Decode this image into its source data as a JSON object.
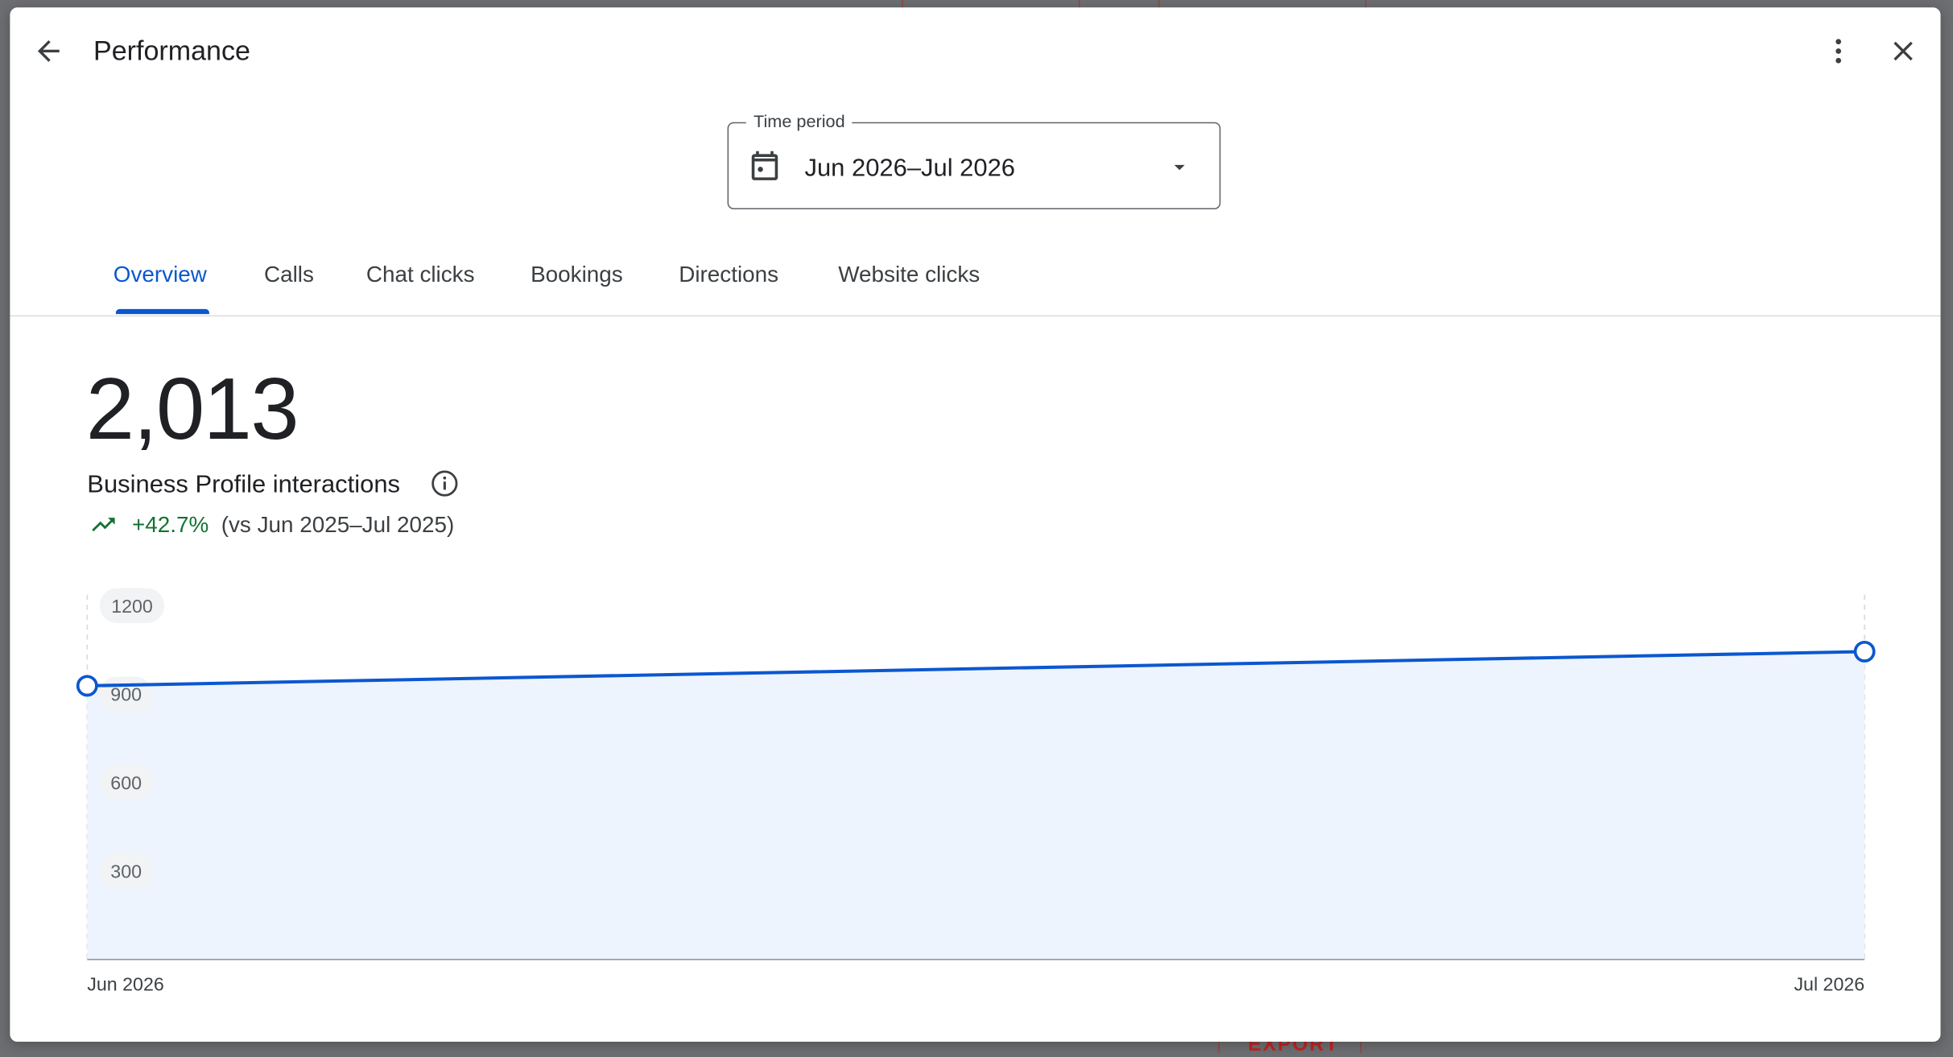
{
  "dialog": {
    "title": "Performance",
    "icons": {
      "back": "arrow-back-icon",
      "more": "more-vert-icon",
      "close": "close-icon"
    }
  },
  "time_period": {
    "label": "Time period",
    "value": "Jun 2026–Jul 2026",
    "icons": {
      "calendar": "calendar-icon",
      "dropdown": "dropdown-arrow-icon"
    }
  },
  "tabs": [
    {
      "label": "Overview",
      "active": true
    },
    {
      "label": "Calls",
      "active": false
    },
    {
      "label": "Chat clicks",
      "active": false
    },
    {
      "label": "Bookings",
      "active": false
    },
    {
      "label": "Directions",
      "active": false
    },
    {
      "label": "Website clicks",
      "active": false
    }
  ],
  "summary": {
    "total": "2,013",
    "label": "Business Profile interactions",
    "change": "+42.7%",
    "comparison": "(vs Jun 2025–Jul 2025)",
    "icons": {
      "info": "info-icon",
      "trend": "trending-up-icon"
    }
  },
  "colors": {
    "accent": "#0b57d0",
    "positive": "#137333",
    "area_fill": "#eef4fd",
    "tick_label_bg": "#f1f3f4"
  },
  "backdrop": {
    "peek_label": "EXPORT"
  },
  "chart_data": {
    "type": "area",
    "x": [
      "Jun 2026",
      "Jul 2026"
    ],
    "series": [
      {
        "values": [
          928,
          1044
        ]
      }
    ],
    "yticks": [
      300,
      600,
      900,
      1200
    ],
    "ylim": [
      0,
      1300
    ],
    "grid": false,
    "legend": "none"
  }
}
